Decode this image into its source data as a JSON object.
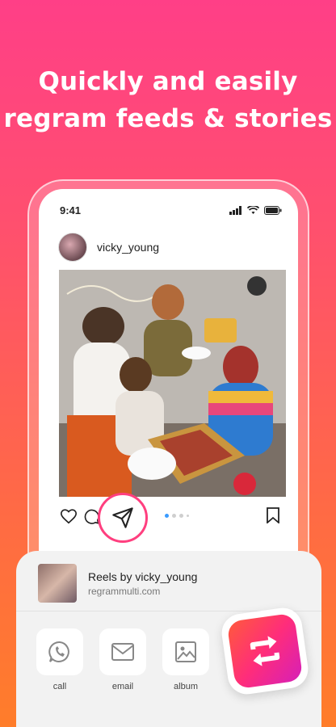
{
  "headline": {
    "line1": "Quickly and easily",
    "line2": "regram feeds & stories"
  },
  "status_bar": {
    "time": "9:41",
    "icons": [
      "signal-icon",
      "wifi-icon",
      "battery-icon"
    ]
  },
  "post": {
    "username": "vicky_young",
    "actions": [
      "heart-icon",
      "comment-icon",
      "bookmark-icon"
    ],
    "carousel": {
      "count": 4,
      "active": 0
    }
  },
  "share_sheet": {
    "title": "Reels by vicky_young",
    "subtitle": "regrammulti.com",
    "targets": [
      {
        "label": "call",
        "icon": "whatsapp-icon"
      },
      {
        "label": "email",
        "icon": "email-icon"
      },
      {
        "label": "album",
        "icon": "album-icon"
      }
    ]
  },
  "colors": {
    "accent": "#ff3f7f",
    "gradient_top": "#ff3f87",
    "gradient_bottom": "#ff7d2a",
    "dot_active": "#3a9bff"
  }
}
